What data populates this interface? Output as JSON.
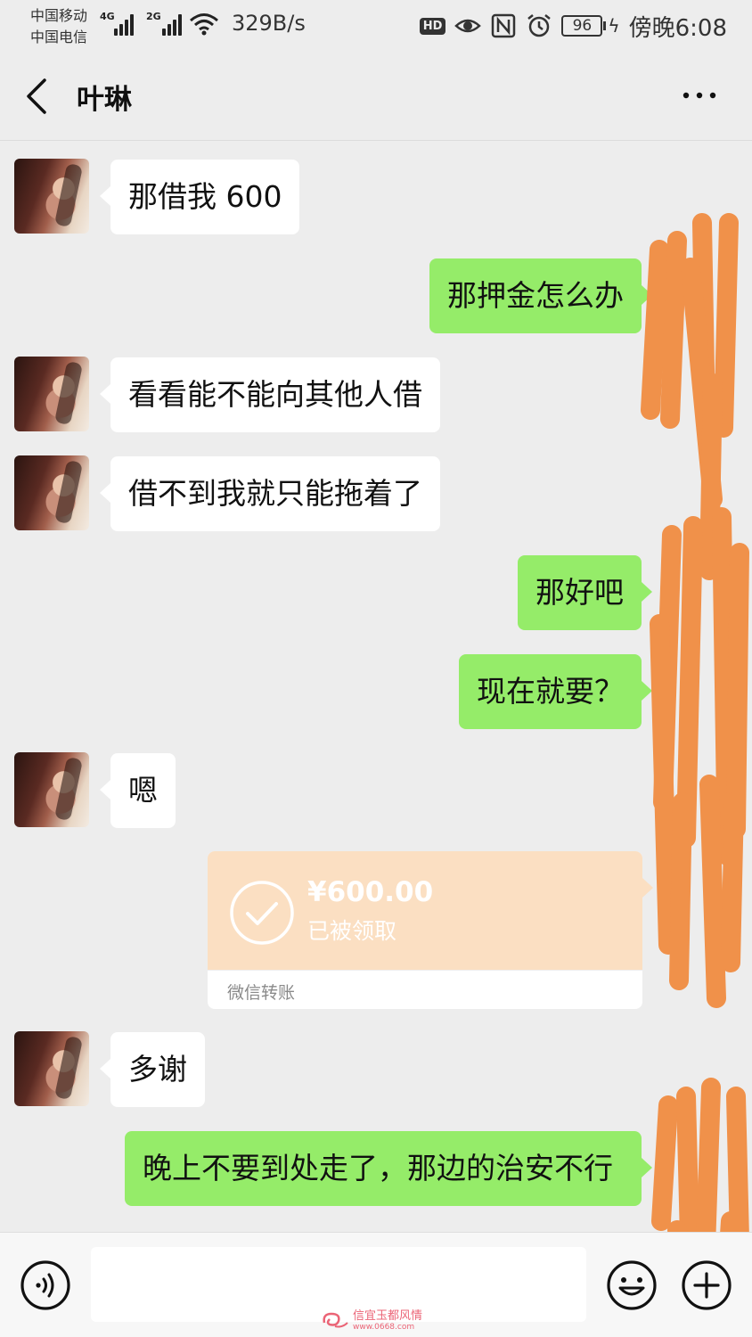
{
  "status_bar": {
    "carrier_1": "中国移动",
    "carrier_2": "中国电信",
    "net_1": "4G",
    "net_2": "2G",
    "speed": "329B/s",
    "hd": "HD",
    "battery": "96",
    "time": "傍晚6:08",
    "icons": [
      "signal-icon",
      "wifi-icon",
      "eye-icon",
      "nfc-icon",
      "alarm-icon",
      "battery-icon",
      "charging-icon"
    ]
  },
  "header": {
    "title": "叶琳",
    "icons": [
      "back-icon",
      "more-icon"
    ]
  },
  "messages": [
    {
      "side": "in",
      "text": "那借我 600"
    },
    {
      "side": "out",
      "text": "那押金怎么办"
    },
    {
      "side": "in",
      "text": "看看能不能向其他人借"
    },
    {
      "side": "in",
      "text": "借不到我就只能拖着了"
    },
    {
      "side": "out",
      "text": "那好吧"
    },
    {
      "side": "out",
      "text": "现在就要？"
    },
    {
      "side": "in",
      "text": "嗯"
    },
    {
      "side": "in",
      "text": "多谢"
    },
    {
      "side": "out",
      "text": "晚上不要到处走了，那边的治安不行"
    }
  ],
  "transfer": {
    "amount": "¥600.00",
    "status": "已被领取",
    "label": "微信转账",
    "icon": "check-circle-icon"
  },
  "colors": {
    "background": "#ededed",
    "incoming_bubble": "#ffffff",
    "outgoing_bubble": "#95ec69",
    "transfer_card": "#fbdfc2",
    "redaction": "#f0914a"
  },
  "input_bar": {
    "value": "",
    "icons": [
      "voice-icon",
      "emoji-icon",
      "plus-icon"
    ]
  },
  "watermark": {
    "text": "信宜玉都风情",
    "url": "www.0668.com"
  }
}
